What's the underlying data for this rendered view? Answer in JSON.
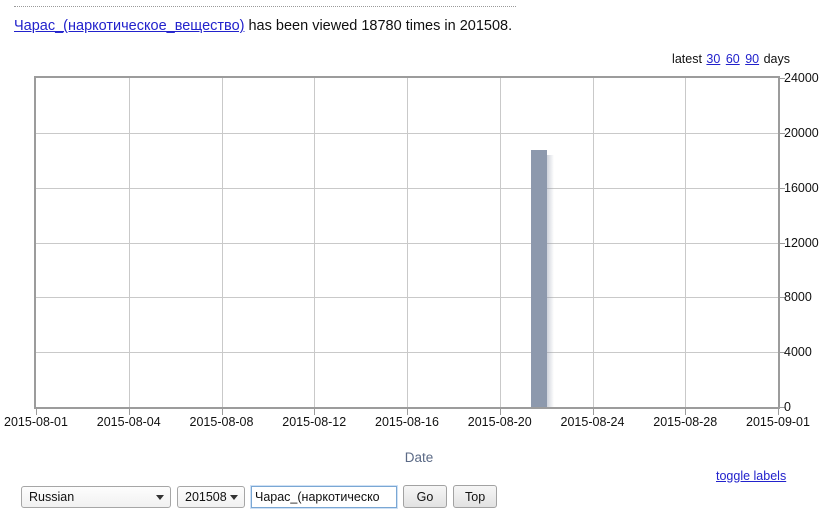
{
  "header": {
    "page_link_text": "Чарас_(наркотическое_вещество)",
    "sentence_rest": " has been viewed 18780 times in 201508."
  },
  "latest": {
    "prefix": "latest",
    "options": [
      "30",
      "60",
      "90"
    ],
    "suffix": "days"
  },
  "footer": {
    "toggle_labels": "toggle labels"
  },
  "form": {
    "language": "Russian",
    "period": "201508",
    "page_value": "Чарас_(наркотическо",
    "go_label": "Go",
    "top_label": "Top"
  },
  "chart_data": {
    "type": "bar",
    "title": "",
    "xlabel": "Date",
    "ylabel": "",
    "grid": true,
    "legend": "none",
    "xlim": [
      "2015-07-31",
      "2015-09-01"
    ],
    "ylim": [
      0,
      24000
    ],
    "ytick_labels": [
      "0",
      "4000",
      "8000",
      "12000",
      "16000",
      "20000",
      "24000"
    ],
    "ytick_values": [
      0,
      4000,
      8000,
      12000,
      16000,
      20000,
      24000
    ],
    "xtick_labels": [
      "2015-08-01",
      "2015-08-04",
      "2015-08-08",
      "2015-08-12",
      "2015-08-16",
      "2015-08-20",
      "2015-08-24",
      "2015-08-28",
      "2015-09-01"
    ],
    "xtick_positions": [
      0,
      0.125,
      0.25,
      0.375,
      0.5,
      0.625,
      0.75,
      0.875,
      1.0
    ],
    "bar_color": "#8d99ad",
    "categories": [
      "2015-08-22"
    ],
    "values": [
      18780
    ]
  }
}
